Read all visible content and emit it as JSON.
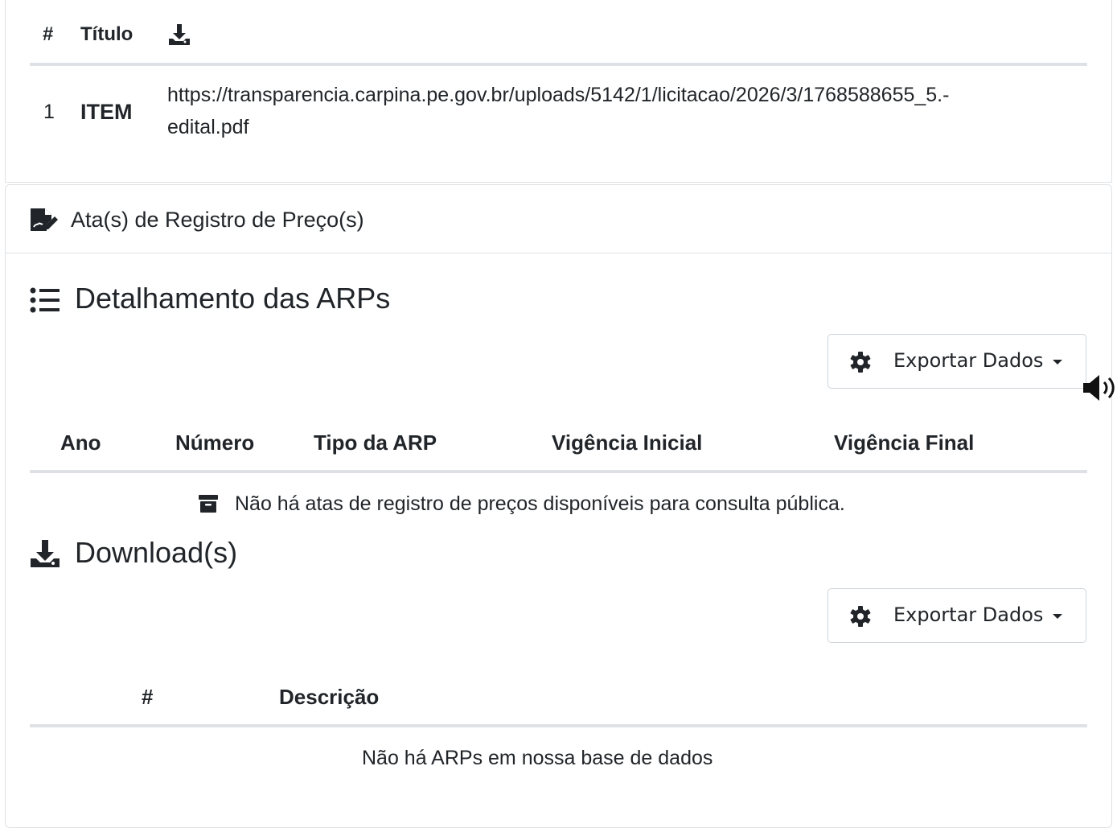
{
  "documents": {
    "headers": {
      "num": "#",
      "title": "Título",
      "download_icon": "download-icon"
    },
    "rows": [
      {
        "num": "1",
        "title": "ITEM",
        "link_line1": "https://transparencia.carpina.pe.gov.br/uploads/5142/1/licitacao/2026/3/1768588655_5.-",
        "link_line2": "edital.pdf"
      }
    ]
  },
  "arp_card": {
    "header_icon": "file-signature-icon",
    "header_title": "Ata(s) de Registro de Preço(s)",
    "detail": {
      "icon": "list-icon",
      "title": "Detalhamento das ARPs",
      "export_label": "Exportar Dados",
      "columns": [
        "Ano",
        "Número",
        "Tipo da ARP",
        "Vigência Inicial",
        "Vigência Final"
      ],
      "empty_icon": "archive-icon",
      "empty_message": "Não há atas de registro de preços disponíveis para consulta pública."
    },
    "downloads": {
      "icon": "download-icon",
      "title": "Download(s)",
      "export_label": "Exportar Dados",
      "columns": [
        "#",
        "Descrição"
      ],
      "empty_message": "Não há ARPs em nossa base de dados"
    }
  },
  "accessibility": {
    "audio_icon": "volume-icon"
  },
  "colors": {
    "border": "#dee2e6",
    "text": "#212529",
    "button_border": "#ced4da"
  }
}
